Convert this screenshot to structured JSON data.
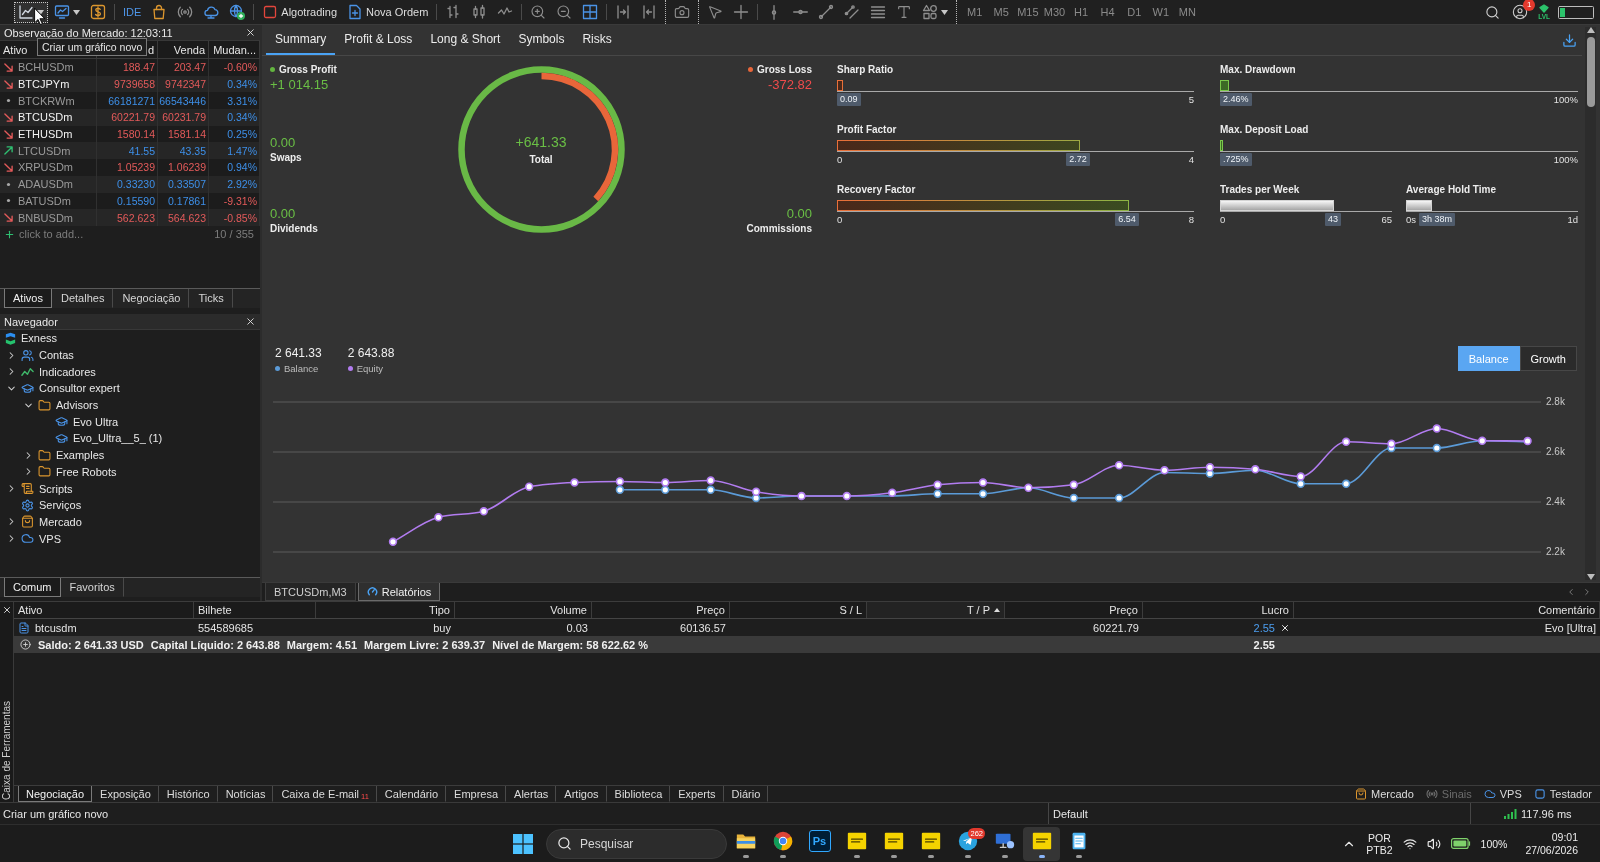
{
  "toolbar": {
    "groups": [
      {
        "kind": "start",
        "items": [
          {
            "kind": "new-chart",
            "dropdown": true,
            "hovered": true
          },
          {
            "kind": "profiles",
            "dropdown": true,
            "hovered": false
          },
          {
            "kind": "dollar",
            "hovered": false
          }
        ]
      },
      {
        "kind": "rule",
        "items": [
          {
            "kind": "text",
            "label": "IDE"
          },
          {
            "kind": "bag"
          },
          {
            "kind": "signal"
          },
          {
            "kind": "cloud"
          },
          {
            "kind": "globe"
          }
        ]
      },
      {
        "kind": "rule",
        "items": [
          {
            "kind": "algo",
            "label": "Algotrading"
          },
          {
            "kind": "new-order",
            "label": "Nova Ordem"
          }
        ]
      },
      {
        "kind": "rule",
        "items": [
          {
            "kind": "bars"
          },
          {
            "kind": "candles"
          },
          {
            "kind": "line"
          }
        ]
      },
      {
        "kind": "rule",
        "items": [
          {
            "kind": "zoom-in"
          },
          {
            "kind": "zoom-out"
          },
          {
            "kind": "grid"
          }
        ]
      },
      {
        "kind": "rule",
        "items": [
          {
            "kind": "shift"
          },
          {
            "kind": "autoscroll"
          }
        ]
      },
      {
        "kind": "gripper",
        "items": [
          {
            "kind": "camera"
          }
        ]
      },
      {
        "kind": "gripper",
        "items": [
          {
            "kind": "cursor"
          },
          {
            "kind": "crosshair"
          }
        ]
      },
      {
        "kind": "rule",
        "items": [
          {
            "kind": "vline"
          },
          {
            "kind": "hline"
          },
          {
            "kind": "trend"
          },
          {
            "kind": "channel"
          },
          {
            "kind": "fibo"
          },
          {
            "kind": "text-tool"
          },
          {
            "kind": "shapes",
            "dropdown": true
          }
        ]
      }
    ],
    "timeframes": [
      {
        "label": "M1",
        "selected": false
      },
      {
        "label": "M5",
        "selected": false
      },
      {
        "label": "M15",
        "selected": false
      },
      {
        "label": "M30",
        "selected": false
      },
      {
        "label": "H1",
        "selected": false
      },
      {
        "label": "H4",
        "selected": false
      },
      {
        "label": "D1",
        "selected": false
      },
      {
        "label": "W1",
        "selected": false
      },
      {
        "label": "MN",
        "selected": false
      }
    ],
    "notification_count": "1",
    "level_label": "LVL"
  },
  "tooltip": {
    "text": "Criar um gráfico novo"
  },
  "market_watch": {
    "title": "Observação do Mercado: 12:03:11",
    "columns": [
      "Ativo",
      "d",
      "Venda",
      "Mudan..."
    ],
    "rows": [
      {
        "symbol": "BCHUSDm",
        "bid": "188.47",
        "ask": "203.47",
        "change": "-0.60%",
        "kind": "down",
        "dimmed": true,
        "change_negative": true
      },
      {
        "symbol": "BTCJPYm",
        "bid": "9739658",
        "ask": "9742347",
        "change": "0.34%",
        "kind": "down",
        "dimmed": false,
        "change_negative": false
      },
      {
        "symbol": "BTCKRWm",
        "bid": "66181271",
        "ask": "66543446",
        "change": "3.31%",
        "kind": "flat",
        "dimmed": true,
        "change_negative": false
      },
      {
        "symbol": "BTCUSDm",
        "bid": "60221.79",
        "ask": "60231.79",
        "change": "0.34%",
        "kind": "down",
        "dimmed": false,
        "change_negative": false
      },
      {
        "symbol": "ETHUSDm",
        "bid": "1580.14",
        "ask": "1581.14",
        "change": "0.25%",
        "kind": "down",
        "dimmed": false,
        "change_negative": false
      },
      {
        "symbol": "LTCUSDm",
        "bid": "41.55",
        "ask": "43.35",
        "change": "1.47%",
        "kind": "up",
        "dimmed": true,
        "change_negative": false
      },
      {
        "symbol": "XRPUSDm",
        "bid": "1.05239",
        "ask": "1.06239",
        "change": "0.94%",
        "kind": "down",
        "dimmed": true,
        "change_negative": false
      },
      {
        "symbol": "ADAUSDm",
        "bid": "0.33230",
        "ask": "0.33507",
        "change": "2.92%",
        "kind": "flat",
        "dimmed": true,
        "change_negative": false
      },
      {
        "symbol": "BATUSDm",
        "bid": "0.15590",
        "ask": "0.17861",
        "change": "-9.31%",
        "kind": "flat",
        "dimmed": true,
        "change_negative": true
      },
      {
        "symbol": "BNBUSDm",
        "bid": "562.623",
        "ask": "564.623",
        "change": "-0.85%",
        "kind": "down",
        "dimmed": true,
        "change_negative": true
      }
    ],
    "add_hint": "click to add...",
    "count": "10 / 355",
    "tabs": [
      {
        "label": "Ativos",
        "selected": true
      },
      {
        "label": "Detalhes",
        "selected": false
      },
      {
        "label": "Negociação",
        "selected": false
      },
      {
        "label": "Ticks",
        "selected": false
      }
    ]
  },
  "navigator": {
    "title": "Navegador",
    "tree": [
      {
        "label": "Exness",
        "kind": "broker",
        "children": [
          {
            "label": "Contas",
            "kind": "accounts",
            "expanded": false
          },
          {
            "label": "Indicadores",
            "kind": "indicators",
            "expanded": false
          },
          {
            "label": "Consultor expert",
            "kind": "experts",
            "expanded": true,
            "children": [
              {
                "label": "Advisors",
                "kind": "folder",
                "expanded": true,
                "children": [
                  {
                    "label": "Evo Ultra",
                    "kind": "expert"
                  },
                  {
                    "label": "Evo_Ultra__5_ (1)",
                    "kind": "expert"
                  }
                ]
              },
              {
                "label": "Examples",
                "kind": "folder",
                "expanded": false
              },
              {
                "label": "Free Robots",
                "kind": "folder",
                "expanded": false
              }
            ]
          },
          {
            "label": "Scripts",
            "kind": "scripts",
            "expanded": false
          },
          {
            "label": "Serviços",
            "kind": "services"
          },
          {
            "label": "Mercado",
            "kind": "market",
            "expanded": false
          },
          {
            "label": "VPS",
            "kind": "vps",
            "expanded": false
          }
        ]
      }
    ],
    "tabs": [
      {
        "label": "Comum",
        "selected": true
      },
      {
        "label": "Favoritos",
        "selected": false
      }
    ]
  },
  "reports": {
    "tabs": [
      {
        "label": "Summary",
        "selected": true
      },
      {
        "label": "Profit & Loss",
        "selected": false
      },
      {
        "label": "Long & Short",
        "selected": false
      },
      {
        "label": "Symbols",
        "selected": false
      },
      {
        "label": "Risks",
        "selected": false
      }
    ],
    "left_stats": [
      {
        "kind": "headline",
        "label": "Gross Profit",
        "value": "+1 014.15",
        "color": "#63b53f",
        "negative": false
      },
      {
        "kind": "minor",
        "label": "Swaps",
        "value": "0.00",
        "negative": false
      },
      {
        "kind": "minor",
        "label": "Dividends",
        "value": "0.00",
        "negative": false
      }
    ],
    "total": {
      "value": "+641.33",
      "label": "Total"
    },
    "right_stats": [
      {
        "kind": "headline",
        "label": "Gross Loss",
        "value": "-372.82",
        "color": "#e8663a",
        "negative": true
      },
      {
        "kind": "minor",
        "label": "Commissions",
        "value": "0.00",
        "negative": false
      }
    ],
    "meter_rows": [
      [
        {
          "label": "Sharp Ratio",
          "kind": "ratio",
          "level": 0.018,
          "badge": "0.09",
          "max": "5"
        },
        {
          "label": "Max. Drawdown",
          "kind": "load",
          "level": 0.0246,
          "badge": "2.46%",
          "max": "100%"
        }
      ],
      [
        {
          "label": "Profit Factor",
          "kind": "ratio",
          "level": 0.68,
          "badge": "2.72",
          "min": "0",
          "max": "4"
        },
        {
          "label": "Max. Deposit Load",
          "kind": "load",
          "level": 0.00725,
          "badge": ".725%",
          "max": "100%"
        }
      ],
      [
        {
          "label": "Recovery Factor",
          "kind": "ratio",
          "level": 0.8175,
          "badge": "6.54",
          "min": "0",
          "max": "8"
        },
        {
          "label": "Trades per Week",
          "kind": "count",
          "level": 0.66,
          "badge": "43",
          "min": "0",
          "max": "65"
        },
        {
          "label": "Average Hold Time",
          "kind": "count",
          "level": 0.15,
          "badge": "3h 38m",
          "min": "0s",
          "max": "1d"
        }
      ]
    ],
    "legend": [
      {
        "value": "2 641.33"
      },
      {
        "value": "2 643.88"
      }
    ],
    "view_buttons": [
      {
        "label": "Balance",
        "selected": true
      },
      {
        "label": "Growth",
        "selected": false
      }
    ],
    "chart_data": {
      "type": "line",
      "grid": true,
      "categories": [
        null,
        null,
        null,
        null,
        null,
        null,
        null,
        null,
        null,
        null,
        null,
        null,
        null,
        null,
        null,
        null,
        null,
        null,
        null,
        null,
        null,
        null,
        null,
        null,
        null,
        null
      ],
      "ylim": [
        2200,
        2800
      ],
      "yticks": [
        {
          "value": 2200,
          "label": "2.2k"
        },
        {
          "value": 2400,
          "label": "2.4k"
        },
        {
          "value": 2600,
          "label": "2.6k"
        },
        {
          "value": 2800,
          "label": "2.8k"
        }
      ],
      "series": [
        {
          "name": "Balance",
          "color": "#5b9bd8",
          "marker": true,
          "values": [
            null,
            null,
            null,
            null,
            null,
            2449,
            2449,
            2449,
            2416,
            2424,
            2424,
            2424,
            2433,
            2433,
            2457,
            2416,
            2416,
            2518,
            2514,
            2527,
            2473,
            2473,
            2616,
            2616,
            2645,
            2641
          ]
        },
        {
          "name": "Equity",
          "color": "#b27cf0",
          "marker": true,
          "values": [
            2241,
            2339,
            2363,
            2461,
            2478,
            2482,
            2478,
            2486,
            2441,
            2424,
            2424,
            2437,
            2469,
            2478,
            2457,
            2469,
            2547,
            2527,
            2539,
            2531,
            2502,
            2641,
            2633,
            2694,
            2645,
            2644
          ]
        }
      ]
    }
  },
  "chart_tabs": [
    {
      "label": "BTCUSDm,M3",
      "kind": "chart",
      "selected": false
    },
    {
      "label": "Relatórios",
      "kind": "report",
      "selected": true
    }
  ],
  "toolbox": {
    "side_title": "Caixa de Ferramentas",
    "columns": [
      {
        "label": "Ativo",
        "sorted": false
      },
      {
        "label": "Bilhete",
        "sorted": false
      },
      {
        "label": "Tipo",
        "sorted": false
      },
      {
        "label": "Volume",
        "sorted": false
      },
      {
        "label": "Preço",
        "sorted": false
      },
      {
        "label": "S / L",
        "sorted": false
      },
      {
        "label": "T / P",
        "sorted": true
      },
      {
        "label": "Preço",
        "sorted": false
      },
      {
        "label": "Lucro",
        "sorted": false
      },
      {
        "label": "Comentário",
        "sorted": false
      }
    ],
    "positions": [
      {
        "symbol": "btcusdm",
        "ticket": "554589685",
        "type": "buy",
        "volume": "0.03",
        "open_price": "60136.57",
        "current_price": "60221.79",
        "profit": "2.55",
        "comment": "Evo [Ultra]"
      }
    ],
    "totals": {
      "items": [
        "Saldo: 2 641.33 USD",
        "Capital Líquido: 2 643.88",
        "Margem: 4.51",
        "Margem Livre: 2 639.37",
        "Nível de Margem: 58 622.62 %"
      ],
      "profit": "2.55"
    },
    "tabs": [
      {
        "label": "Negociação",
        "selected": true
      },
      {
        "label": "Exposição",
        "selected": false
      },
      {
        "label": "Histórico",
        "selected": false
      },
      {
        "label": "Notícias",
        "selected": false
      },
      {
        "label": "Caixa de E-mail",
        "selected": false,
        "badge": "11"
      },
      {
        "label": "Calendário",
        "selected": false
      },
      {
        "label": "Empresa",
        "selected": false
      },
      {
        "label": "Alertas",
        "selected": false
      },
      {
        "label": "Artigos",
        "selected": false
      },
      {
        "label": "Biblioteca",
        "selected": false
      },
      {
        "label": "Experts",
        "selected": false
      },
      {
        "label": "Diário",
        "selected": false
      }
    ],
    "shortcuts": [
      {
        "label": "Mercado",
        "kind": "market",
        "disabled": false
      },
      {
        "label": "Sinais",
        "kind": "signals",
        "disabled": true
      },
      {
        "label": "VPS",
        "kind": "vps",
        "disabled": false
      },
      {
        "label": "Testador",
        "kind": "tester",
        "disabled": false
      }
    ]
  },
  "status_bar": {
    "message": "Criar um gráfico novo",
    "profile": "Default",
    "ping": "117.96 ms"
  },
  "taskbar": {
    "search": {
      "placeholder": "Pesquisar"
    },
    "apps": [
      {
        "kind": "explorer",
        "running": true,
        "selected": false
      },
      {
        "kind": "browser",
        "running": true,
        "selected": false
      },
      {
        "kind": "tile",
        "label": "Ps",
        "running": false,
        "selected": false
      },
      {
        "kind": "note",
        "running": true,
        "selected": false
      },
      {
        "kind": "note",
        "running": true,
        "selected": false
      },
      {
        "kind": "note",
        "running": true,
        "selected": false
      },
      {
        "kind": "messenger",
        "badge": "262",
        "running": true,
        "selected": false
      },
      {
        "kind": "remote",
        "running": true,
        "selected": false
      },
      {
        "kind": "note",
        "running": true,
        "selected": true
      },
      {
        "kind": "notepad",
        "running": true,
        "selected": false
      }
    ],
    "tray": {
      "language": "POR",
      "keyboard": "PTB2",
      "battery": "100%",
      "time": "09:01",
      "date": "27/06/2026"
    }
  }
}
